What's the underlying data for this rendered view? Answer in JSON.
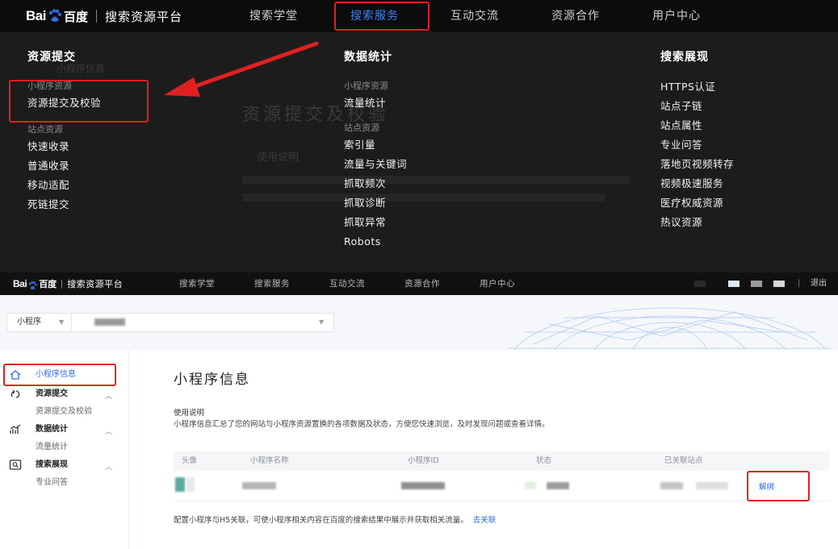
{
  "brand": {
    "logo_bai": "Bai",
    "logo_du": "百度",
    "platform_name": "搜索资源平台"
  },
  "top_nav": [
    {
      "label": "搜索学堂"
    },
    {
      "label": "搜索服务"
    },
    {
      "label": "互动交流"
    },
    {
      "label": "资源合作"
    },
    {
      "label": "用户中心"
    }
  ],
  "mega_menu": {
    "col1": {
      "title": "资源提交",
      "group1_label": "小程序资源",
      "group1_items": [
        "资源提交及校验"
      ],
      "group2_label": "站点资源",
      "group2_items": [
        "快速收录",
        "普通收录",
        "移动适配",
        "死链提交"
      ]
    },
    "col2": {
      "title": "数据统计",
      "group1_label": "小程序资源",
      "group1_items": [
        "流量统计"
      ],
      "group2_label": "站点资源",
      "group2_items": [
        "索引量",
        "流量与关键词",
        "抓取频次",
        "抓取诊断",
        "抓取异常",
        "Robots"
      ]
    },
    "col3": {
      "title": "搜索展现",
      "items": [
        "HTTPS认证",
        "站点子链",
        "站点属性",
        "专业问答",
        "落地页视频转存",
        "视频极速服务",
        "医疗权威资源",
        "热议资源"
      ]
    }
  },
  "ghost_page": {
    "title": "资源提交及校验",
    "section": "使用说明",
    "side_info": "小程序信息"
  },
  "console": {
    "nav": [
      "搜索学堂",
      "搜索服务",
      "互动交流",
      "资源合作",
      "用户中心"
    ],
    "logout": "退出",
    "selector_label": "小程序",
    "sidebar": {
      "info": "小程序信息",
      "submit_group": "资源提交",
      "submit_item": "资源提交及校验",
      "stats_group": "数据统计",
      "stats_item": "流量统计",
      "display_group": "搜索展现",
      "display_item": "专业问答"
    },
    "page_title": "小程序信息",
    "usage_heading": "使用说明",
    "usage_text": "小程序信息汇总了您的网站与小程序资源置换的各项数据及状态，方便您快速浏览，及时发现问题或查看详情。",
    "table": {
      "headers": [
        "头像",
        "小程序名称",
        "小程序ID",
        "状态",
        "已关联站点"
      ],
      "action": "解绑"
    },
    "footer_text": "配置小程序与H5关联，可使小程序相关内容在百度的搜索结果中展示并获取相关流量。",
    "footer_link": "去关联"
  },
  "colors": {
    "accent_blue": "#3b82f6",
    "annotation_red": "#e02020",
    "link_blue": "#2f6be4"
  }
}
